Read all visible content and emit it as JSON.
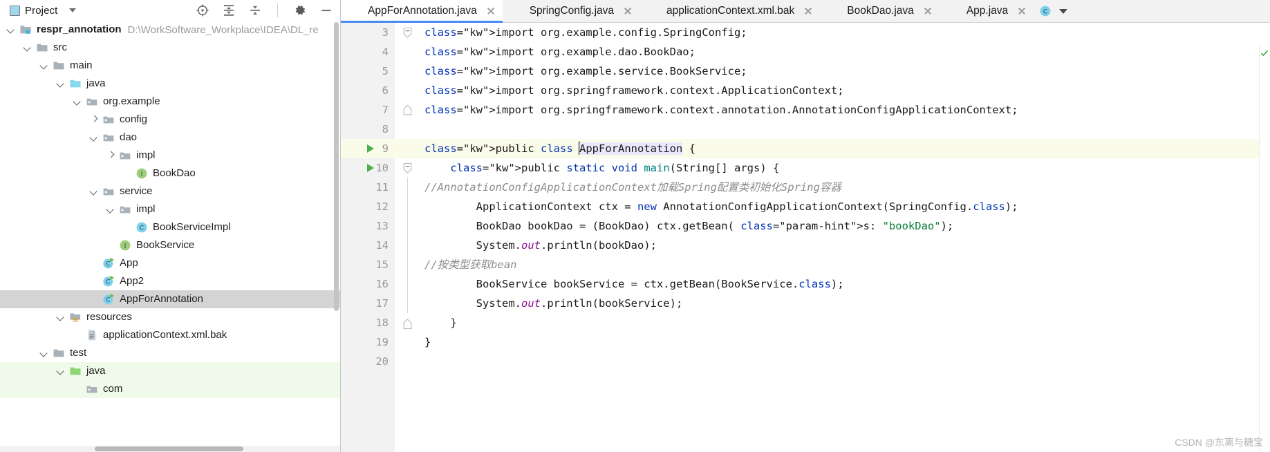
{
  "project_panel": {
    "title": "Project",
    "icons": {
      "window_mode": "project-window-icon",
      "dropdown": "chevron-down-icon",
      "locate": "locate-target-icon",
      "expand_all": "expand-all-icon",
      "collapse_all": "collapse-all-icon",
      "settings": "gear-icon",
      "hide": "minimize-icon"
    },
    "tree": [
      {
        "label": "respr_annotation",
        "path": "D:\\WorkSoftware_Workplace\\IDEA\\DL_re",
        "depth": 0,
        "arrow": "down",
        "icon": "module-folder",
        "bold": true,
        "state": "normal"
      },
      {
        "label": "src",
        "path": "",
        "depth": 1,
        "arrow": "down",
        "icon": "folder-gray",
        "bold": false,
        "state": "normal"
      },
      {
        "label": "main",
        "path": "",
        "depth": 2,
        "arrow": "down",
        "icon": "folder-gray",
        "bold": false,
        "state": "normal"
      },
      {
        "label": "java",
        "path": "",
        "depth": 3,
        "arrow": "down",
        "icon": "folder-source-blue",
        "bold": false,
        "state": "normal"
      },
      {
        "label": "org.example",
        "path": "",
        "depth": 4,
        "arrow": "down",
        "icon": "folder-package",
        "bold": false,
        "state": "normal"
      },
      {
        "label": "config",
        "path": "",
        "depth": 5,
        "arrow": "right",
        "icon": "folder-package",
        "bold": false,
        "state": "normal"
      },
      {
        "label": "dao",
        "path": "",
        "depth": 5,
        "arrow": "down",
        "icon": "folder-package",
        "bold": false,
        "state": "normal"
      },
      {
        "label": "impl",
        "path": "",
        "depth": 6,
        "arrow": "right",
        "icon": "folder-package",
        "bold": false,
        "state": "normal"
      },
      {
        "label": "BookDao",
        "path": "",
        "depth": 7,
        "arrow": "none",
        "icon": "interface-icon",
        "bold": false,
        "state": "normal"
      },
      {
        "label": "service",
        "path": "",
        "depth": 5,
        "arrow": "down",
        "icon": "folder-package",
        "bold": false,
        "state": "normal"
      },
      {
        "label": "impl",
        "path": "",
        "depth": 6,
        "arrow": "down",
        "icon": "folder-package",
        "bold": false,
        "state": "normal"
      },
      {
        "label": "BookServiceImpl",
        "path": "",
        "depth": 7,
        "arrow": "none",
        "icon": "class-icon",
        "bold": false,
        "state": "normal"
      },
      {
        "label": "BookService",
        "path": "",
        "depth": 6,
        "arrow": "none",
        "icon": "interface-icon",
        "bold": false,
        "state": "normal"
      },
      {
        "label": "App",
        "path": "",
        "depth": 5,
        "arrow": "none",
        "icon": "runnable-class-icon",
        "bold": false,
        "state": "normal"
      },
      {
        "label": "App2",
        "path": "",
        "depth": 5,
        "arrow": "none",
        "icon": "runnable-class-icon",
        "bold": false,
        "state": "normal"
      },
      {
        "label": "AppForAnnotation",
        "path": "",
        "depth": 5,
        "arrow": "none",
        "icon": "runnable-class-icon",
        "bold": false,
        "state": "selected"
      },
      {
        "label": "resources",
        "path": "",
        "depth": 3,
        "arrow": "down",
        "icon": "folder-resources",
        "bold": false,
        "state": "normal"
      },
      {
        "label": "applicationContext.xml.bak",
        "path": "",
        "depth": 4,
        "arrow": "none",
        "icon": "file-text-icon",
        "bold": false,
        "state": "normal"
      },
      {
        "label": "test",
        "path": "",
        "depth": 2,
        "arrow": "down",
        "icon": "folder-gray",
        "bold": false,
        "state": "normal"
      },
      {
        "label": "java",
        "path": "",
        "depth": 3,
        "arrow": "down",
        "icon": "folder-test-green",
        "bold": false,
        "state": "testsrc"
      },
      {
        "label": "com",
        "path": "",
        "depth": 4,
        "arrow": "none",
        "icon": "folder-package",
        "bold": false,
        "state": "testsrc"
      }
    ]
  },
  "editor": {
    "tabs": [
      {
        "label": "AppForAnnotation.java",
        "icon": "runnable-class-icon",
        "active": true,
        "closable": true
      },
      {
        "label": "SpringConfig.java",
        "icon": "class-icon",
        "active": false,
        "closable": true
      },
      {
        "label": "applicationContext.xml.bak",
        "icon": "file-text-icon",
        "active": false,
        "closable": true
      },
      {
        "label": "BookDao.java",
        "icon": "interface-icon",
        "active": false,
        "closable": true
      },
      {
        "label": "App.java",
        "icon": "runnable-class-icon",
        "active": false,
        "closable": true
      }
    ],
    "overflow_tab": {
      "icon": "class-icon",
      "chevron": "chevron-down-icon"
    },
    "caret_line": 9,
    "lines": [
      {
        "num": 3,
        "run": false,
        "fold": "fold-end-top",
        "guide": false
      },
      {
        "num": 4,
        "run": false,
        "fold": "none",
        "guide": false
      },
      {
        "num": 5,
        "run": false,
        "fold": "none",
        "guide": false
      },
      {
        "num": 6,
        "run": false,
        "fold": "none",
        "guide": false
      },
      {
        "num": 7,
        "run": false,
        "fold": "fold-end-bot",
        "guide": false
      },
      {
        "num": 8,
        "run": false,
        "fold": "none",
        "guide": false
      },
      {
        "num": 9,
        "run": true,
        "fold": "none",
        "guide": false
      },
      {
        "num": 10,
        "run": true,
        "fold": "fold-open",
        "guide": false
      },
      {
        "num": 11,
        "run": false,
        "fold": "none",
        "guide": true
      },
      {
        "num": 12,
        "run": false,
        "fold": "none",
        "guide": true
      },
      {
        "num": 13,
        "run": false,
        "fold": "none",
        "guide": true
      },
      {
        "num": 14,
        "run": false,
        "fold": "none",
        "guide": true
      },
      {
        "num": 15,
        "run": false,
        "fold": "none",
        "guide": true
      },
      {
        "num": 16,
        "run": false,
        "fold": "none",
        "guide": true
      },
      {
        "num": 17,
        "run": false,
        "fold": "none",
        "guide": true
      },
      {
        "num": 18,
        "run": false,
        "fold": "fold-close",
        "guide": false
      },
      {
        "num": 19,
        "run": false,
        "fold": "none",
        "guide": false
      },
      {
        "num": 20,
        "run": false,
        "fold": "none",
        "guide": false
      }
    ],
    "code_text": [
      "import org.example.config.SpringConfig;",
      "import org.example.dao.BookDao;",
      "import org.example.service.BookService;",
      "import org.springframework.context.ApplicationContext;",
      "import org.springframework.context.annotation.AnnotationConfigApplicationContext;",
      "",
      "public class AppForAnnotation {",
      "    public static void main(String[] args) {",
      "        //AnnotationConfigApplicationContext加载Spring配置类初始化Spring容器",
      "        ApplicationContext ctx = new AnnotationConfigApplicationContext(SpringConfig.class);",
      "        BookDao bookDao = (BookDao) ctx.getBean( s: \"bookDao\");",
      "        System.out.println(bookDao);",
      "        //按类型获取bean",
      "        BookService bookService = ctx.getBean(BookService.class);",
      "        System.out.println(bookService);",
      "    }",
      "}",
      ""
    ],
    "param_hint": "s:",
    "inspection_status": "no-problems-check-icon"
  },
  "watermark": "CSDN @东离与糖宝",
  "colors": {
    "keyword": "#0033b3",
    "string": "#087c34",
    "comment": "#8c8c8c",
    "method": "#00807f",
    "field": "#871094",
    "caret_line_bg": "#fbfbe9",
    "tab_active_underline": "#4688f0",
    "tree_selection": "#d4d4d4",
    "test_source_bg": "#effaea"
  }
}
